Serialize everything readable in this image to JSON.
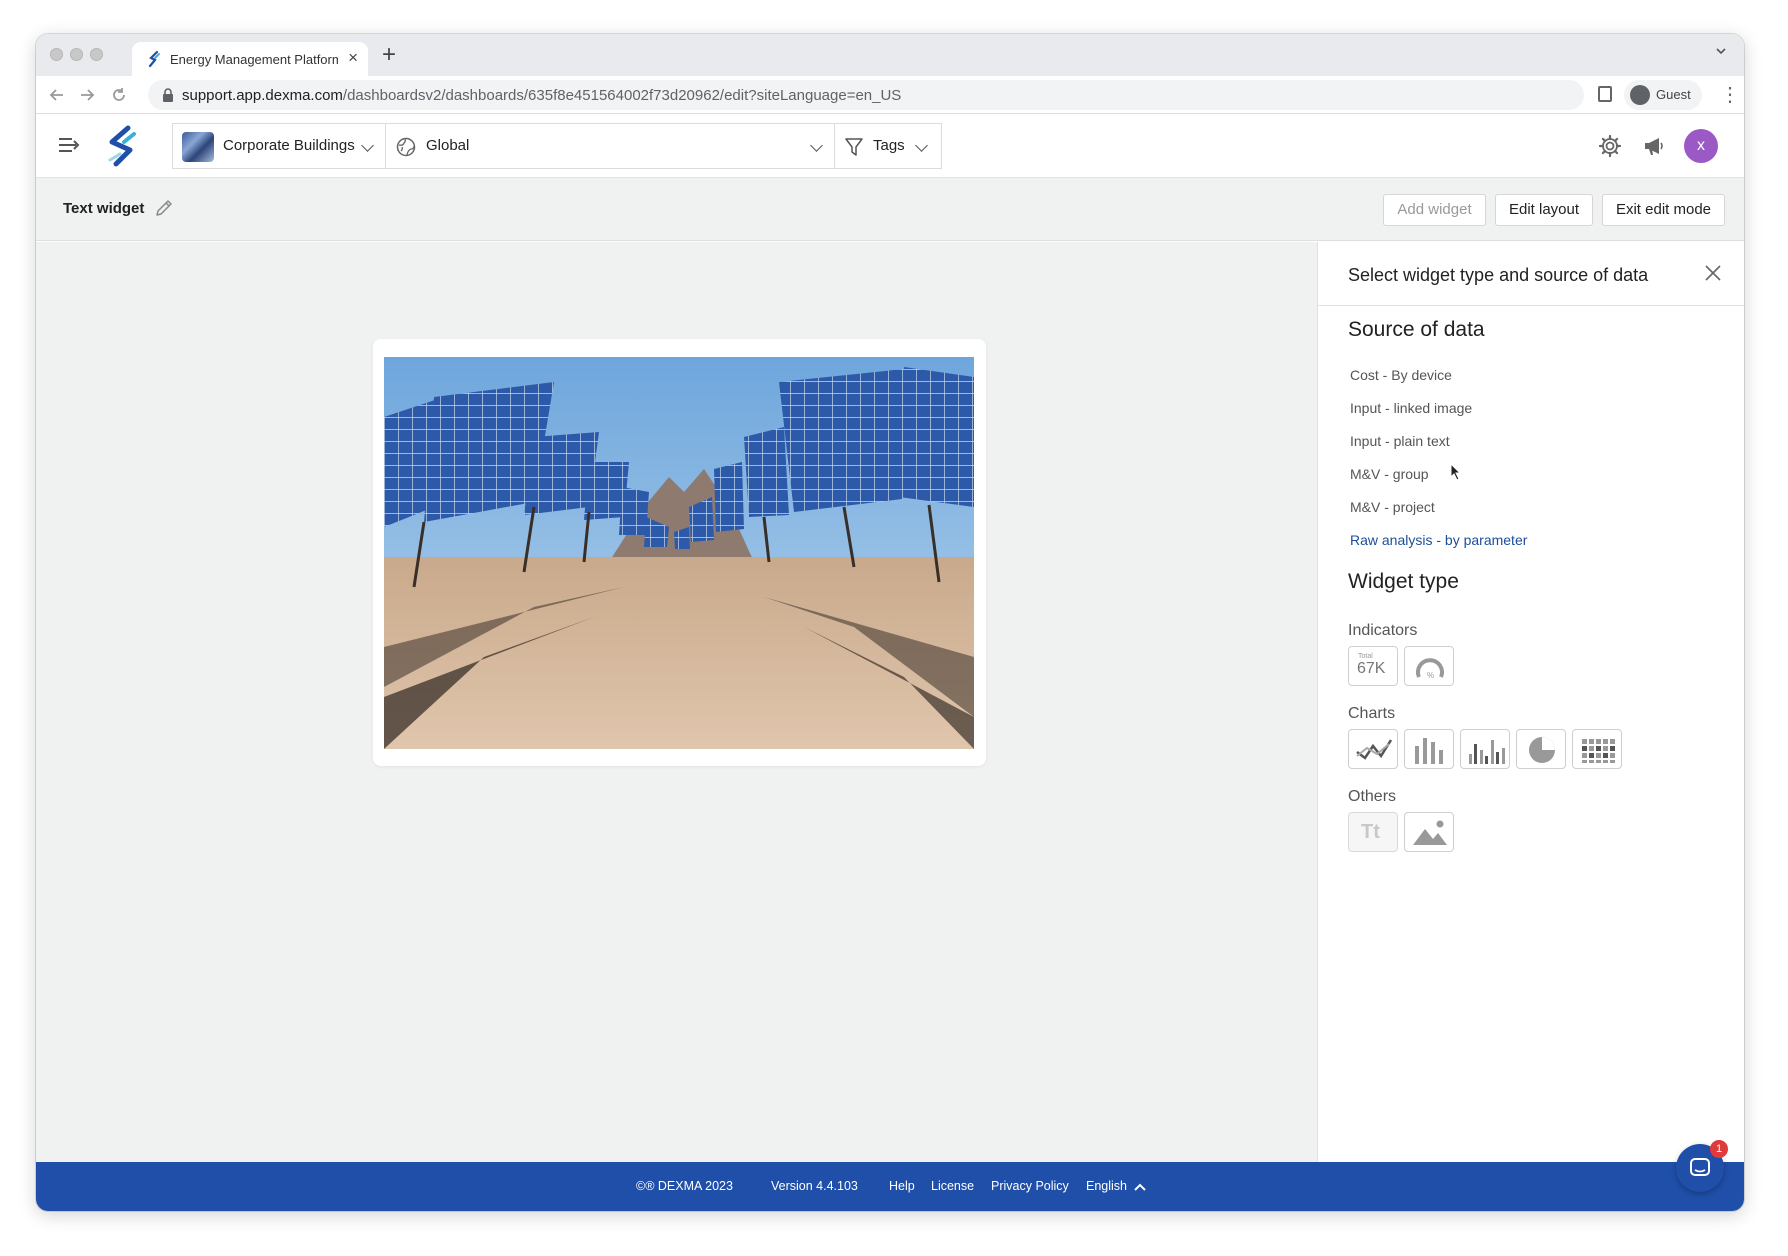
{
  "browser": {
    "tab_title": "Energy Management Platform",
    "tab_close": "×",
    "new_tab": "+",
    "url_host": "support.app.dexma.com",
    "url_path": "/dashboardsv2/dashboards/635f8e451564002f73d20962/edit?siteLanguage=en_US",
    "profile_label": "Guest",
    "menu": "⋮"
  },
  "header": {
    "building_selector": "Corporate Buildings",
    "scope_selector": "Global",
    "tags_selector": "Tags",
    "user_initial": "x"
  },
  "editbar": {
    "widget_title": "Text widget",
    "add_widget": "Add widget",
    "edit_layout": "Edit layout",
    "exit_edit_mode": "Exit edit mode"
  },
  "panel": {
    "title": "Select widget type and source of data",
    "source_heading": "Source of data",
    "sources": [
      "Cost - By device",
      "Input - linked image",
      "Input - plain text",
      "M&V - group",
      "M&V - project",
      "Raw analysis - by parameter"
    ],
    "widget_type_heading": "Widget type",
    "indicators_label": "Indicators",
    "charts_label": "Charts",
    "others_label": "Others",
    "indicator_value_text": "67K",
    "indicator_small_text": "Total",
    "gauge_text": "%",
    "text_widget_glyph": "Tt"
  },
  "footer": {
    "copyright": "©® DEXMA 2023",
    "version": "Version 4.4.103",
    "help": "Help",
    "license": "License",
    "privacy": "Privacy Policy",
    "language": "English",
    "chat_badge": "1"
  },
  "colors": {
    "brand_blue": "#1f4fa8",
    "active_link": "#1d4e9a",
    "avatar_purple": "#9b59c6"
  }
}
